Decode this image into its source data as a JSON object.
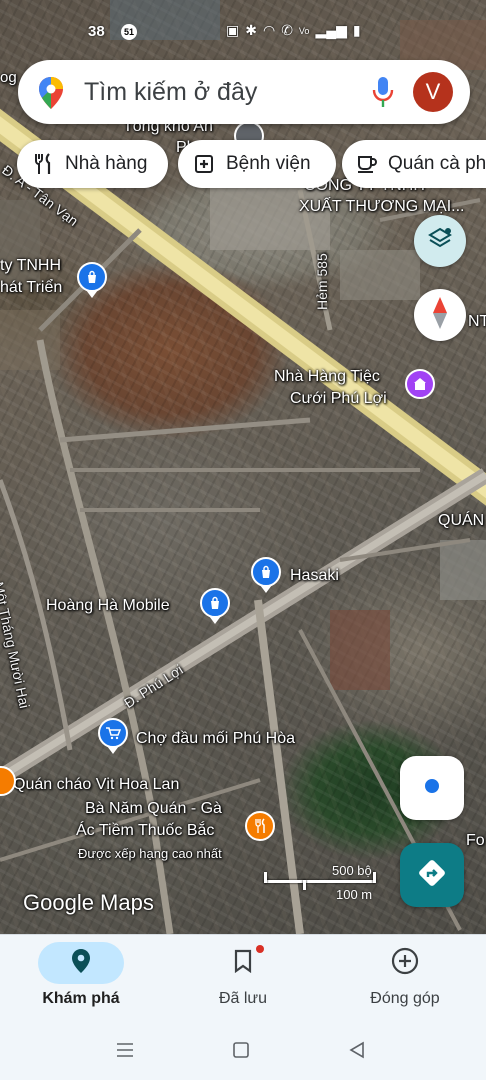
{
  "status_bar": {
    "time": "38",
    "notification_count": "51",
    "icons": [
      "nfc-icon",
      "bluetooth-icon",
      "wifi-icon",
      "wifi-call-icon",
      "volte-icon",
      "signal-icon"
    ]
  },
  "search": {
    "placeholder": "Tìm kiếm ở đây",
    "avatar_initial": "V",
    "avatar_color": "#b5321c"
  },
  "chips": [
    {
      "label": "Nhà hàng",
      "icon": "fork-knife-icon"
    },
    {
      "label": "Bệnh viện",
      "icon": "hospital-icon"
    },
    {
      "label": "Quán cà phê",
      "icon": "coffee-icon"
    }
  ],
  "map": {
    "labels": {
      "tong_kho": "Tổng kho An",
      "ph": "Ph",
      "cong_ty_1": "CÔNG TY TNHH",
      "xuat_thuong_mai": "XUẤT THƯƠNG MẠI...",
      "road_tan_van": "Đ. A - Tân Vạn",
      "cty_tnhh": "ty TNHH",
      "phat_trien": "hát Triển",
      "hem_585": "Hẻm 585",
      "nt": "NT",
      "nha_hang_tiec": "Nhà Hàng Tiệc",
      "cuoi_phu_loi": "Cưới Phú Lợi",
      "quan": "QUÁN",
      "hasaki": "Hasaki",
      "hoang_ha": "Hoàng Hà Mobile",
      "mot_thang": "Một Tháng Mười Hai",
      "road_phu_loi": "Đ. Phú Lợi",
      "cho_dau_moi": "Chợ đầu mối Phú Hòa",
      "quan_chao": "Quán cháo Vịt Hoa Lan",
      "ba_nam_1": "Bà Năm Quán - Gà",
      "ba_nam_2": "Ác Tiềm Thuốc Bắc",
      "rated": "Được xếp hạng cao nhất",
      "fo": "Fo",
      "og": "og"
    },
    "google_logo": "Google Maps",
    "scale_imperial": "500 bộ",
    "scale_metric": "100 m"
  },
  "bottom_nav": [
    {
      "label": "Khám phá",
      "icon": "explore-pin-icon",
      "active": true
    },
    {
      "label": "Đã lưu",
      "icon": "bookmark-icon",
      "active": false
    },
    {
      "label": "Đóng góp",
      "icon": "add-circle-icon",
      "active": false
    }
  ],
  "colors": {
    "accent": "#1a73e8",
    "nav_active": "#c2e7ff",
    "directions": "#0d7c86",
    "road": "#e8d98a"
  }
}
